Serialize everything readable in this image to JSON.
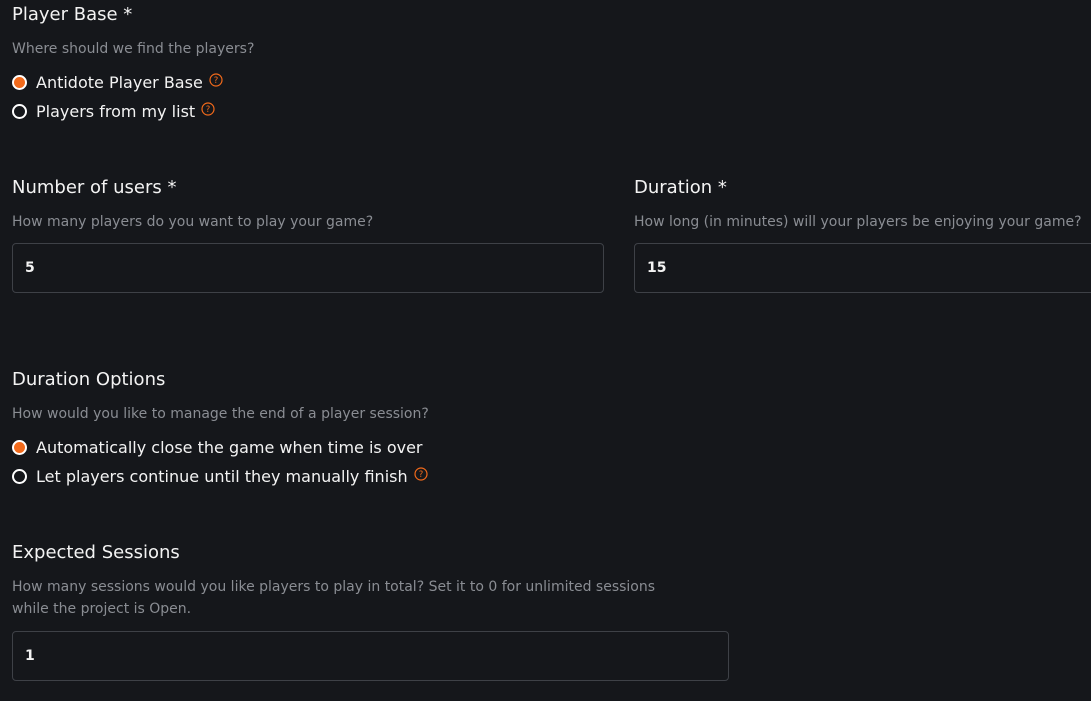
{
  "player_base": {
    "title": "Player Base *",
    "description": "Where should we find the players?",
    "options": [
      {
        "label": "Antidote Player Base",
        "selected": true,
        "has_help": true
      },
      {
        "label": "Players from my list",
        "selected": false,
        "has_help": true
      }
    ]
  },
  "number_of_users": {
    "title": "Number of users *",
    "description": "How many players do you want to play your game?",
    "value": "5"
  },
  "duration": {
    "title": "Duration *",
    "description": "How long (in minutes) will your players be enjoying your game?",
    "value": "15"
  },
  "duration_options": {
    "title": "Duration Options",
    "description": "How would you like to manage the end of a player session?",
    "options": [
      {
        "label": "Automatically close the game when time is over",
        "selected": true,
        "has_help": false
      },
      {
        "label": "Let players continue until they manually finish",
        "selected": false,
        "has_help": true
      }
    ]
  },
  "expected_sessions": {
    "title": "Expected Sessions",
    "description_line1": "How many sessions would you like players to play in total? Set it to 0 for unlimited sessions",
    "description_line2": "while the project is Open.",
    "value": "1"
  },
  "colors": {
    "background": "#15171b",
    "accent": "#f26a1b",
    "muted_text": "#8a8d93",
    "border": "#3e4147"
  },
  "icons": {
    "help": "question-circle-icon"
  }
}
